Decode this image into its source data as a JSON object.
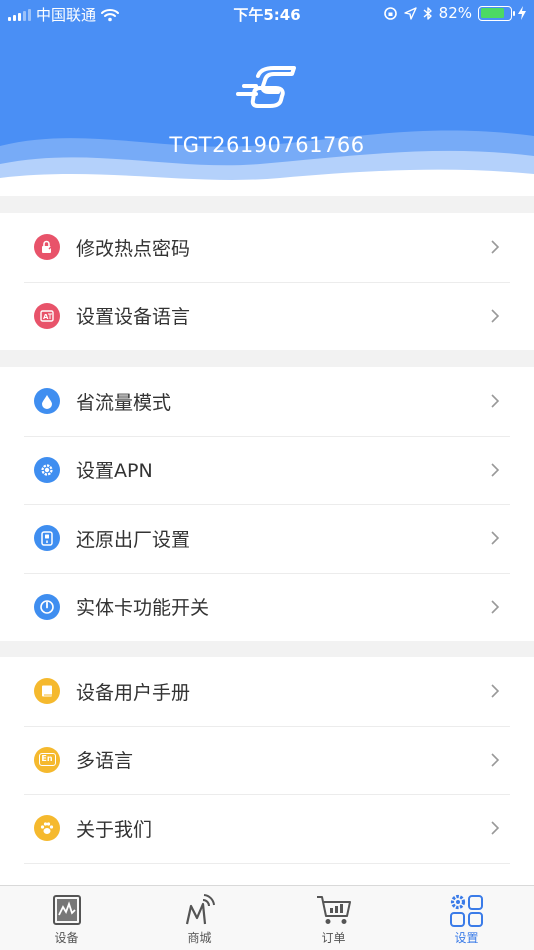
{
  "status_bar": {
    "carrier": "中国联通",
    "time": "下午5:46",
    "battery_percent": "82%",
    "battery_level": 0.82
  },
  "header": {
    "device_id": "TGT26190761766",
    "background_color": "#4a8ff5"
  },
  "groups": [
    {
      "items": [
        {
          "label": "修改热点密码",
          "icon": "lock-edit-icon",
          "color": "#e8536a"
        },
        {
          "label": "设置设备语言",
          "icon": "translate-icon",
          "color": "#e8536a"
        }
      ]
    },
    {
      "items": [
        {
          "label": "省流量模式",
          "icon": "water-drop-icon",
          "color": "#3f8ef0"
        },
        {
          "label": "设置APN",
          "icon": "gear-icon",
          "color": "#3f8ef0"
        },
        {
          "label": "还原出厂设置",
          "icon": "reset-icon",
          "color": "#3f8ef0"
        },
        {
          "label": "实体卡功能开关",
          "icon": "power-icon",
          "color": "#3f8ef0"
        }
      ]
    },
    {
      "items": [
        {
          "label": "设备用户手册",
          "icon": "book-icon",
          "color": "#f5b92e"
        },
        {
          "label": "多语言",
          "icon": "language-icon",
          "color": "#f5b92e",
          "badge": "En"
        },
        {
          "label": "关于我们",
          "icon": "paw-icon",
          "color": "#f5b92e"
        }
      ]
    }
  ],
  "tabbar": {
    "tabs": [
      {
        "label": "设备",
        "icon": "device-icon",
        "active": false
      },
      {
        "label": "商城",
        "icon": "mall-icon",
        "active": false
      },
      {
        "label": "订单",
        "icon": "cart-icon",
        "active": false
      },
      {
        "label": "设置",
        "icon": "settings-icon",
        "active": true
      }
    ],
    "active_color": "#3a7be8"
  }
}
